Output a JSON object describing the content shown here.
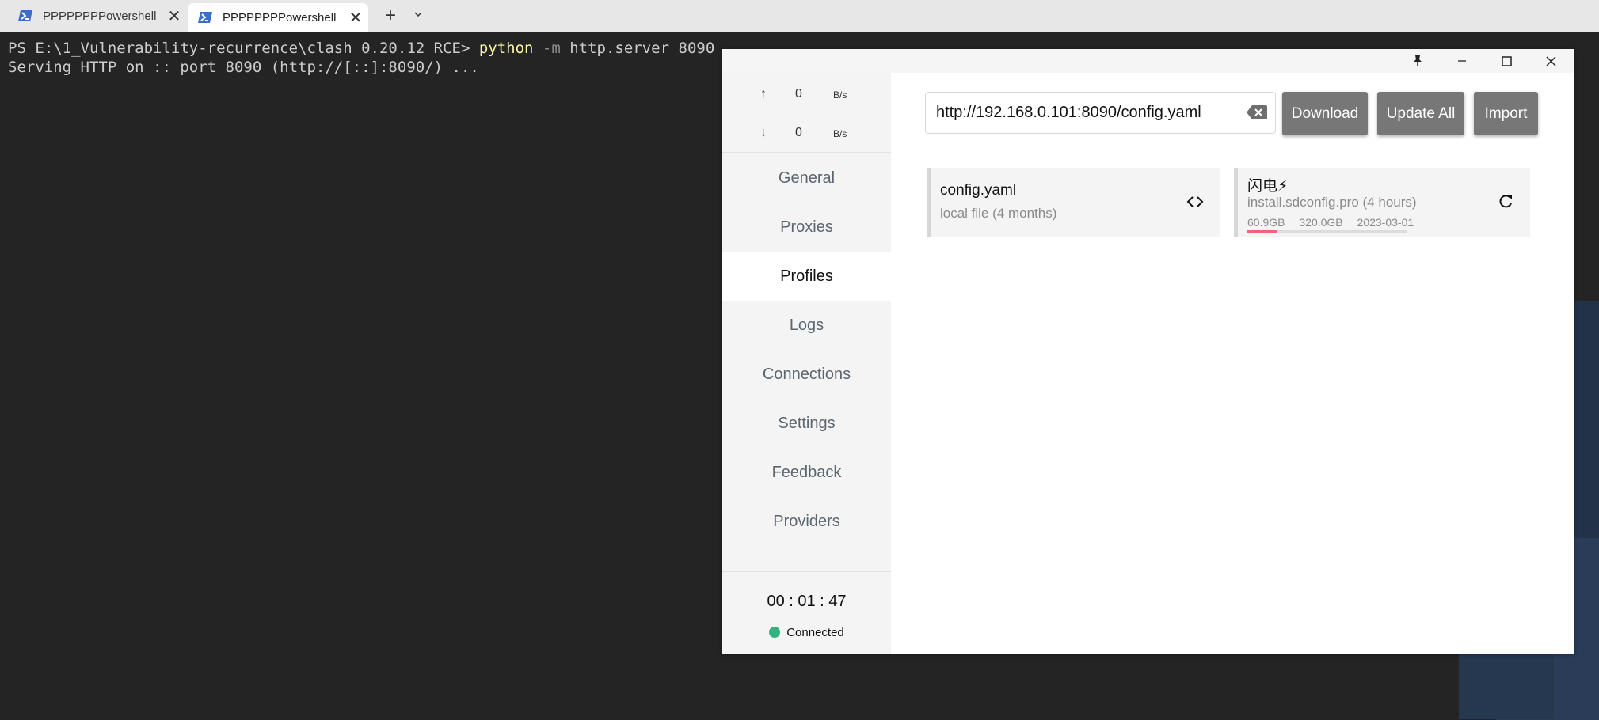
{
  "terminal": {
    "tabs": [
      {
        "title": "PPPPPPPPowershell",
        "active": false
      },
      {
        "title": "PPPPPPPPowershell",
        "active": true
      }
    ],
    "prompt": "PS E:\\1_Vulnerability-recurrence\\clash 0.20.12 RCE> ",
    "command": "python",
    "flag": " -m",
    "args": " http.server 8090",
    "output": "Serving HTTP on :: port 8090 (http://[::]:8090/) ..."
  },
  "clash": {
    "traffic": {
      "up_value": "0",
      "up_unit": "B/s",
      "down_value": "0",
      "down_unit": "B/s"
    },
    "nav": [
      "General",
      "Proxies",
      "Profiles",
      "Logs",
      "Connections",
      "Settings",
      "Feedback",
      "Providers"
    ],
    "active_nav": "Profiles",
    "timer": "00 : 01 : 47",
    "status": "Connected",
    "url_value": "http://192.168.0.101:8090/config.yaml",
    "buttons": {
      "download": "Download",
      "update_all": "Update All",
      "import": "Import"
    },
    "profiles": [
      {
        "name": "config.yaml",
        "sub": "local file (4 months)"
      },
      {
        "name": "闪电⚡",
        "sub": "install.sdconfig.pro (4 hours)",
        "used": "60.9GB",
        "total": "320.0GB",
        "expire": "2023-03-01",
        "usage_fraction": 0.19
      }
    ]
  },
  "colors": {
    "accent_button": "#777777",
    "connected": "#2fb37f",
    "usage_bar": "#f4637a"
  }
}
